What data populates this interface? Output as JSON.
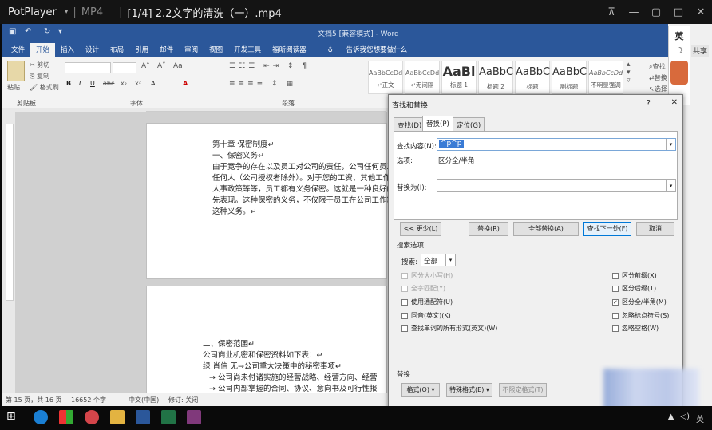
{
  "player": {
    "app": "PotPlayer",
    "format": "MP4",
    "title": "[1/4] 2.2文字的清洗（一）.mp4"
  },
  "word": {
    "doc_title": "文档5 [兼容模式] - Word",
    "tabs": [
      "文件",
      "开始",
      "插入",
      "设计",
      "布局",
      "引用",
      "邮件",
      "审阅",
      "视图",
      "开发工具",
      "福昕阅读器"
    ],
    "active_tab": "开始",
    "tell_me": "告诉我您想要做什么",
    "groups": {
      "clipboard": "剪贴板",
      "font": "字体",
      "paragraph": "段落"
    },
    "clipboard": {
      "paste": "粘贴",
      "cut": "剪切",
      "copy": "复制",
      "format_painter": "格式刷"
    },
    "font_buttons": [
      "B",
      "I",
      "U",
      "abc",
      "x₂",
      "x²",
      "A",
      "A"
    ],
    "styles": [
      {
        "preview": "AaBbCcDd",
        "name": "↵正文"
      },
      {
        "preview": "AaBbCcDd",
        "name": "↵无间隔"
      },
      {
        "preview": "AaBl",
        "name": "标题 1"
      },
      {
        "preview": "AaBbC",
        "name": "标题 2"
      },
      {
        "preview": "AaBbC",
        "name": "标题"
      },
      {
        "preview": "AaBbC",
        "name": "副标题"
      },
      {
        "preview": "AaBbCcDd",
        "name": "不明显强调"
      }
    ],
    "editing": {
      "find": "查找",
      "replace": "替换",
      "select": "选择"
    },
    "doc_lines": [
      "第十章  保密制度↵",
      "一、保密义务↵",
      "由于竞争的存在以及员工对公司的责任，公司任何员工",
      "任何人（公司授权者除外）。对于您的工资、其他工作",
      "人事政策等等，员工都有义务保密。这就是一种良好的",
      "先表现。这种保密的义务，不仅限于员工在公司工作期",
      "这种义务。↵"
    ],
    "doc_lines2": [
      "二、保密范围↵",
      "公司商业机密和保密资料如下表：↵",
      "绿 肖信 无→公司重大决策中的秘密事项↵",
      "→ 公司尚未付诸实施的经营战略、经营方向、经营",
      "→ 公司内部掌握的合同、协议、意向书及可行性报"
    ],
    "status": {
      "page": "第 15 页，共 16 页",
      "words": "16652 个字",
      "lang": "中文(中国)",
      "track": "修订: 关闭"
    }
  },
  "dialog": {
    "title": "查找和替换",
    "help": "?",
    "tabs": [
      "查找(D)",
      "替换(P)",
      "定位(G)"
    ],
    "active_tab": "替换(P)",
    "find_label": "查找内容(N):",
    "find_value": "^p^p",
    "options_label": "选项:",
    "options_value": "区分全/半角",
    "replace_label": "替换为(I):",
    "replace_value": "",
    "buttons": {
      "less": "<< 更少(L)",
      "replace": "替换(R)",
      "replace_all": "全部替换(A)",
      "find_next": "查找下一处(F)",
      "cancel": "取消"
    },
    "search_options_label": "搜索选项",
    "search_label": "搜索:",
    "search_value": "全部",
    "checks_left": [
      {
        "label": "区分大小写(H)",
        "checked": false,
        "enabled": false
      },
      {
        "label": "全字匹配(Y)",
        "checked": false,
        "enabled": false
      },
      {
        "label": "使用通配符(U)",
        "checked": false,
        "enabled": true
      },
      {
        "label": "同音(英文)(K)",
        "checked": false,
        "enabled": true
      },
      {
        "label": "查找单词的所有形式(英文)(W)",
        "checked": false,
        "enabled": true
      }
    ],
    "checks_right": [
      {
        "label": "区分前缀(X)",
        "checked": false,
        "enabled": true
      },
      {
        "label": "区分后缀(T)",
        "checked": false,
        "enabled": true
      },
      {
        "label": "区分全/半角(M)",
        "checked": true,
        "enabled": true
      },
      {
        "label": "忽略标点符号(S)",
        "checked": false,
        "enabled": true
      },
      {
        "label": "忽略空格(W)",
        "checked": false,
        "enabled": true
      }
    ],
    "replace_section": "替换",
    "bottom_buttons": [
      "格式(O) ▾",
      "特殊格式(E) ▾",
      "不限定格式(T)"
    ]
  },
  "ime": {
    "lang": "英",
    "extra": "共享"
  },
  "tray": {
    "lang": "英"
  }
}
